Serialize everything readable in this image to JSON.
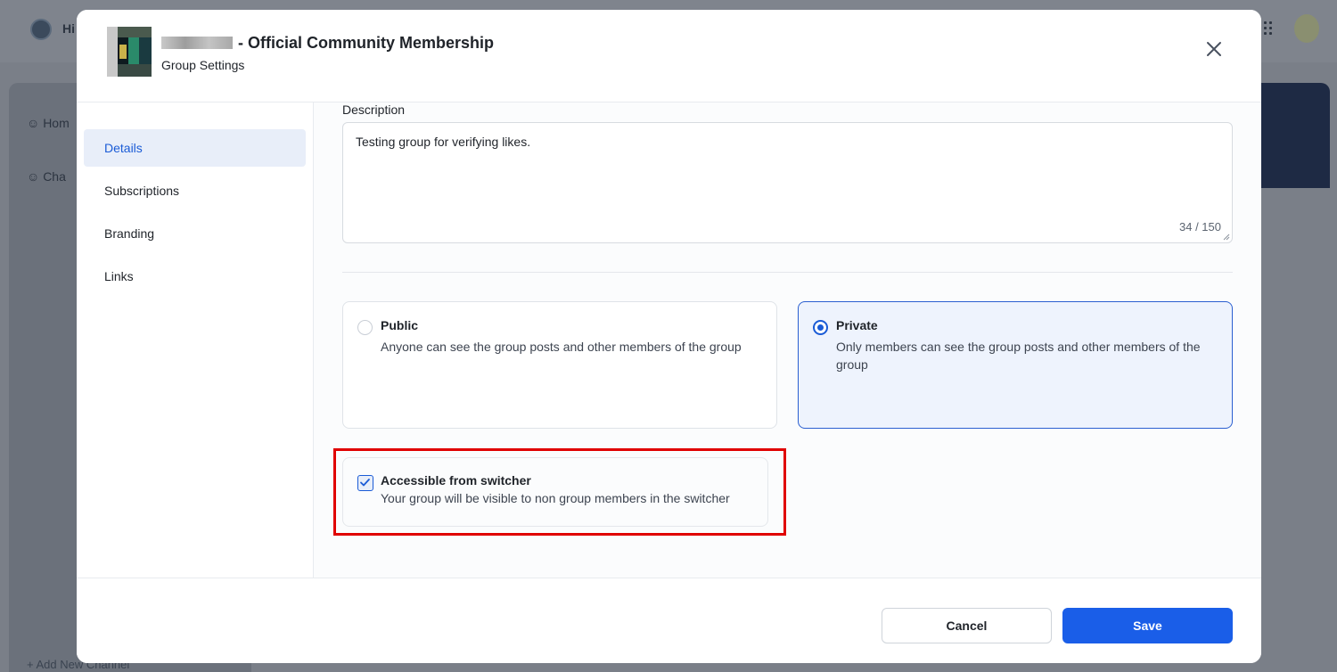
{
  "background": {
    "app_name_partial": "Hi",
    "nav": [
      {
        "label": "Hom",
        "icon": "users-icon"
      },
      {
        "label": "Cha",
        "icon": "smiley-icon"
      }
    ],
    "add_channel_label": "+ Add New Channel"
  },
  "modal": {
    "title": "- Official Community Membership",
    "subtitle": "Group Settings",
    "close_icon": "close-icon"
  },
  "left_nav": {
    "items": [
      {
        "label": "Details",
        "active": true
      },
      {
        "label": "Subscriptions",
        "active": false
      },
      {
        "label": "Branding",
        "active": false
      },
      {
        "label": "Links",
        "active": false
      }
    ]
  },
  "details": {
    "description_label": "Description",
    "description_value": "Testing group for verifying likes.",
    "char_count": "34 / 150",
    "visibility": [
      {
        "title": "Public",
        "description": "Anyone can see the group posts and other members of the group",
        "selected": false
      },
      {
        "title": "Private",
        "description": "Only members can see the group posts and other members of the group",
        "selected": true
      }
    ],
    "switcher": {
      "title": "Accessible from switcher",
      "description": "Your group will be visible to non group members in the switcher",
      "checked": true
    }
  },
  "footer": {
    "cancel_label": "Cancel",
    "save_label": "Save"
  },
  "colors": {
    "primary": "#1a5ee8",
    "active_nav_bg": "#e8eef9",
    "highlight": "#e00000"
  }
}
